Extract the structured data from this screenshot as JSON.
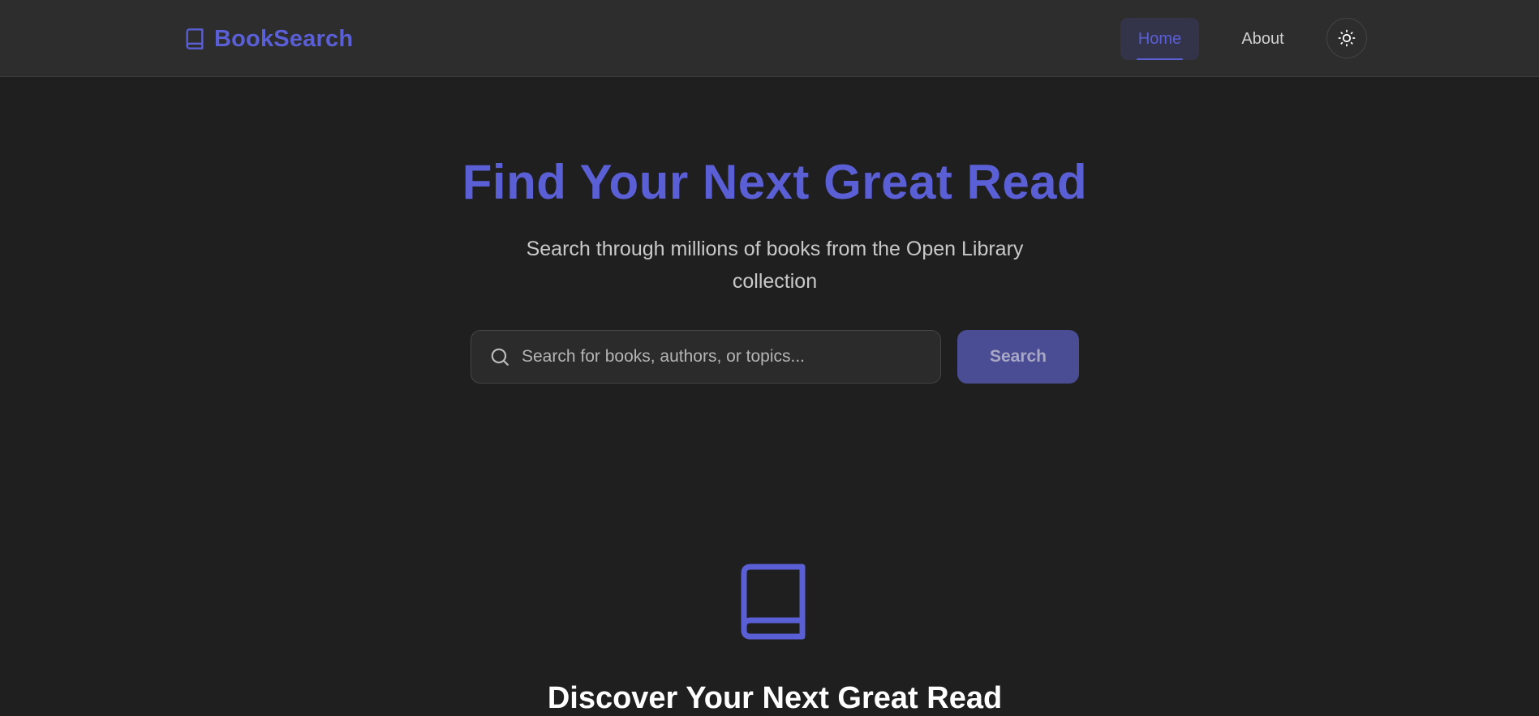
{
  "header": {
    "brand": "BookSearch",
    "brand_icon": "book-icon",
    "nav": [
      {
        "label": "Home",
        "active": true
      },
      {
        "label": "About",
        "active": false
      }
    ],
    "theme_toggle_icon": "sun-icon"
  },
  "hero": {
    "title": "Find Your Next Great Read",
    "subtitle": "Search through millions of books from the Open Library collection"
  },
  "search": {
    "placeholder": "Search for books, authors, or topics...",
    "value": "",
    "button_label": "Search",
    "icon": "search-icon"
  },
  "empty_state": {
    "icon": "book-icon",
    "title": "Discover Your Next Great Read"
  },
  "colors": {
    "accent": "#5b5fd6",
    "background": "#1f1f1f",
    "header_background": "#2d2d2d",
    "button_background": "#4a4c94"
  }
}
